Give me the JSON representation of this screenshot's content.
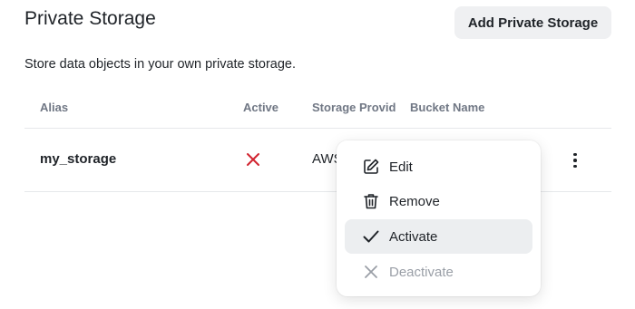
{
  "header": {
    "title": "Private Storage",
    "add_button": "Add Private Storage",
    "subtitle": "Store data objects in your own private storage."
  },
  "table": {
    "columns": [
      "Alias",
      "Active",
      "Storage Provider",
      "Bucket Name"
    ],
    "rows": [
      {
        "alias": "my_storage",
        "active": false,
        "active_icon": "x-icon",
        "provider": "AWS"
      }
    ]
  },
  "menu": {
    "items": [
      {
        "label": "Edit",
        "icon": "pencil-square-icon",
        "enabled": true
      },
      {
        "label": "Remove",
        "icon": "trash-icon",
        "enabled": true
      },
      {
        "label": "Activate",
        "icon": "check-icon",
        "enabled": true,
        "hovered": true
      },
      {
        "label": "Deactivate",
        "icon": "x-icon",
        "enabled": false
      }
    ]
  },
  "colors": {
    "inactive_red": "#d1242f",
    "muted": "#707784",
    "hover_bg": "#eceef0"
  }
}
